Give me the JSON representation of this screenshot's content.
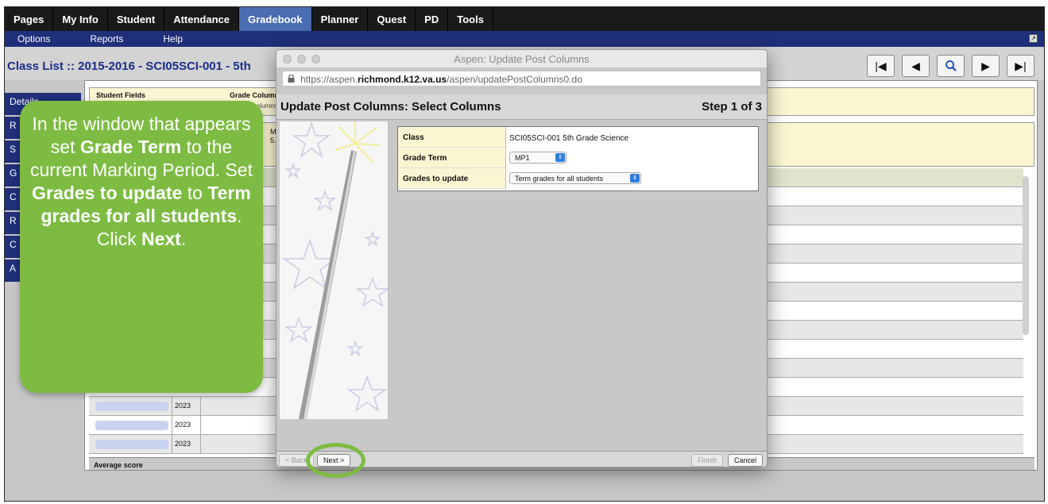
{
  "top_nav": [
    "Pages",
    "My Info",
    "Student",
    "Attendance",
    "Gradebook",
    "Planner",
    "Quest",
    "PD",
    "Tools"
  ],
  "active_tab": "Gradebook",
  "sub_nav": [
    "Options",
    "Reports",
    "Help"
  ],
  "class_title": "Class List :: 2015-2016 - SCI05SCI-001 - 5th",
  "side_tabs": [
    "Details",
    "R",
    "S",
    "G",
    "C M",
    "R S",
    "C",
    "A"
  ],
  "grid": {
    "student_fields_label": "Student Fields",
    "grade_columns_label": "Grade Columns",
    "grade_columns_sub": "columns",
    "column_m": "M",
    "column_5": "5.",
    "years": [
      "2023",
      "2023",
      "2023"
    ],
    "average_label": "Average score"
  },
  "dialog": {
    "window_title": "Aspen: Update Post Columns",
    "url_prefix": "https://aspen.",
    "url_domain": "richmond.k12.va.us",
    "url_path": "/aspen/updatePostColumns0.do",
    "heading": "Update Post Columns: Select Columns",
    "step": "Step 1 of 3",
    "class_label": "Class",
    "class_value": "SCI05SCI-001  5th Grade Science",
    "grade_term_label": "Grade Term",
    "grade_term_value": "MP1",
    "grades_to_update_label": "Grades to update",
    "grades_to_update_value": "Term grades for all students",
    "back_button": "< Back",
    "next_button": "Next >",
    "finish_button": "Finish",
    "cancel_button": "Cancel"
  },
  "callout": {
    "t1": "In the window that appears set ",
    "b1": "Grade Term",
    "t2": " to the current Marking Period. Set ",
    "b2": "Grades to update",
    "t3": " to ",
    "b3": "Term grades for all students",
    "t4": ". Click ",
    "b4": "Next",
    "t5": "."
  },
  "colors": {
    "nav_bg": "#1a1a1a",
    "active_tab": "#4a6cb0",
    "subnav_bg": "#1f2f7a",
    "title_blue": "#1a2e8a",
    "callout_green": "#7dbb42",
    "header_yellow": "#fbf6d2"
  }
}
